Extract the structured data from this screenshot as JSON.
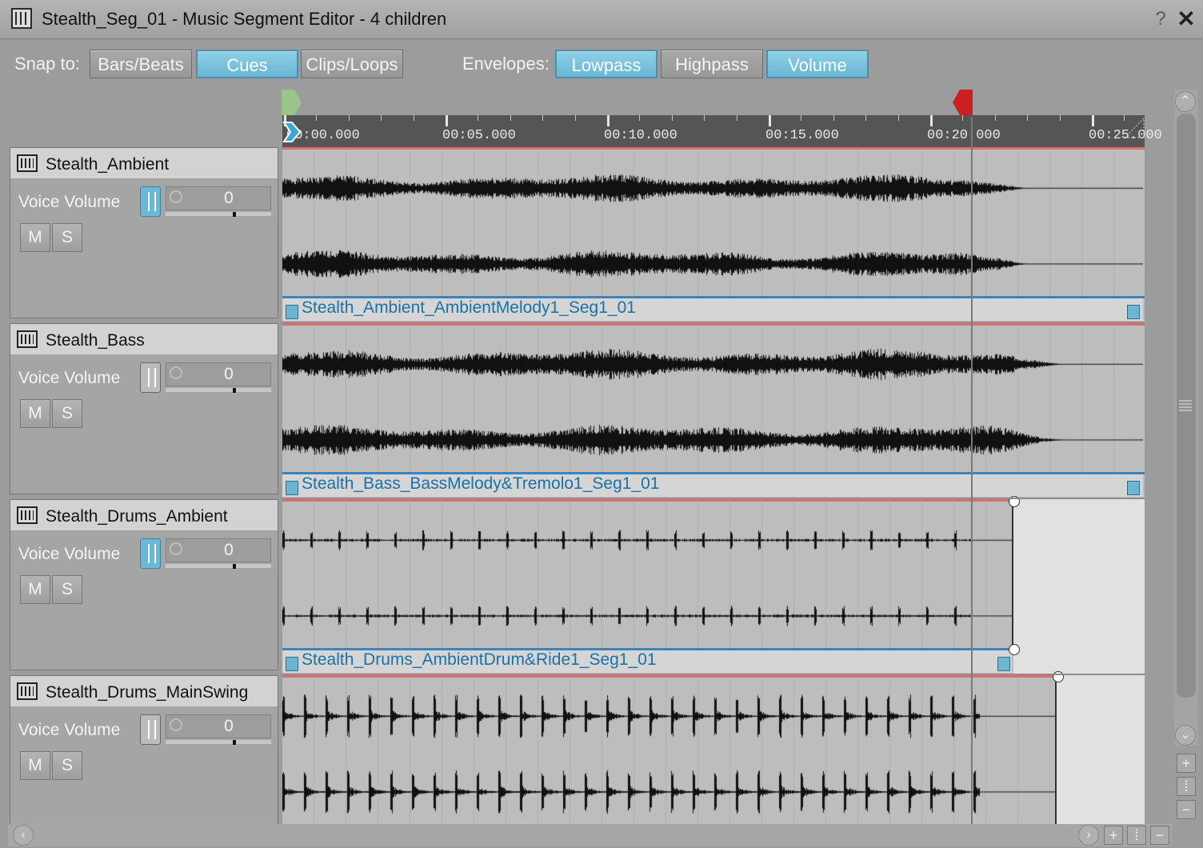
{
  "window": {
    "title": "Stealth_Seg_01 - Music Segment Editor - 4 children",
    "help": "?",
    "close": "✕"
  },
  "toolbar": {
    "snap_label": "Snap to:",
    "snap_buttons": [
      {
        "label": "Bars/Beats",
        "active": false
      },
      {
        "label": "Cues",
        "active": true
      },
      {
        "label": "Clips/Loops",
        "active": false
      }
    ],
    "envelopes_label": "Envelopes:",
    "envelope_buttons": [
      {
        "label": "Lowpass",
        "active": true
      },
      {
        "label": "Highpass",
        "active": false
      },
      {
        "label": "Volume",
        "active": true
      }
    ]
  },
  "ruler": {
    "ticks": [
      "00:00.000",
      "00:05.000",
      "00:10.000",
      "00:15.000",
      "00:20.000",
      "00:25.000"
    ],
    "entry_marker_color": "#9bc48a",
    "exit_marker_color": "#cc1f1f",
    "playhead_color": "#3aa6d8"
  },
  "tracks": [
    {
      "name": "Stealth_Ambient",
      "volume_label": "Voice Volume",
      "volume_value": "0",
      "envelope_on": true,
      "mute": "M",
      "solo": "S",
      "clip": "Stealth_Ambient_AmbientMelody1_Seg1_01"
    },
    {
      "name": "Stealth_Bass",
      "volume_label": "Voice Volume",
      "volume_value": "0",
      "envelope_on": false,
      "mute": "M",
      "solo": "S",
      "clip": "Stealth_Bass_BassMelody&Tremolo1_Seg1_01"
    },
    {
      "name": "Stealth_Drums_Ambient",
      "volume_label": "Voice Volume",
      "volume_value": "0",
      "envelope_on": true,
      "mute": "M",
      "solo": "S",
      "clip": "Stealth_Drums_AmbientDrum&Ride1_Seg1_01"
    },
    {
      "name": "Stealth_Drums_MainSwing",
      "volume_label": "Voice Volume",
      "volume_value": "0",
      "envelope_on": false,
      "mute": "M",
      "solo": "S",
      "clip": ""
    }
  ],
  "colors": {
    "accent": "#6bb8d6",
    "clip_text": "#1a72a8",
    "envelope_red": "#e06c6c",
    "envelope_blue": "#3d82b8"
  }
}
